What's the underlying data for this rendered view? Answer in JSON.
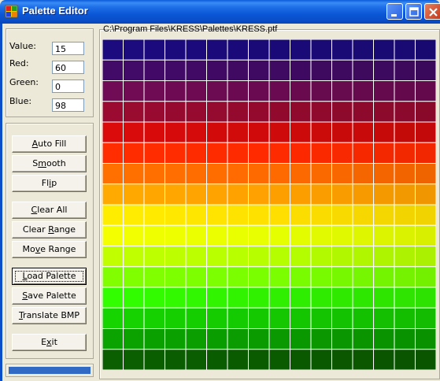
{
  "window": {
    "title": "Palette Editor",
    "icon": "palette-app-icon",
    "controls": [
      "minimize-icon",
      "maximize-icon",
      "close-icon"
    ]
  },
  "values": {
    "value_label": "Value:",
    "value": "15",
    "red_label": "Red:",
    "red": "60",
    "green_label": "Green:",
    "green": "0",
    "blue_label": "Blue:",
    "blue": "98"
  },
  "buttons": {
    "auto_fill": {
      "pre": "",
      "key": "A",
      "post": "uto Fill"
    },
    "smooth": {
      "pre": "S",
      "key": "m",
      "post": "ooth"
    },
    "flip": {
      "pre": "Fl",
      "key": "i",
      "post": "p"
    },
    "clear_all": {
      "pre": "",
      "key": "C",
      "post": "lear All"
    },
    "clear_range": {
      "pre": "Clear ",
      "key": "R",
      "post": "ange"
    },
    "move_range": {
      "pre": "Mo",
      "key": "v",
      "post": "e Range"
    },
    "load_palette": {
      "pre": "",
      "key": "L",
      "post": "oad Palette"
    },
    "save_palette": {
      "pre": "",
      "key": "S",
      "post": "ave Palette"
    },
    "translate_bmp": {
      "pre": "",
      "key": "T",
      "post": "ranslate BMP"
    },
    "exit": {
      "pre": "E",
      "key": "x",
      "post": "it"
    }
  },
  "status": {
    "progress": 1.0,
    "color": "#316ac5"
  },
  "palette": {
    "path": "C:\\Program Files\\KRESS\\Palettes\\KRESS.ptf",
    "columns": 16,
    "rows": 16,
    "grid_color": "#ffffff",
    "row_colors": [
      "#1a0a78",
      "#3f0a62",
      "#6a0a50",
      "#920a2e",
      "#cf0a0a",
      "#ff2a00",
      "#ff6a00",
      "#ffa000",
      "#ffe000",
      "#e6ff00",
      "#b6ff00",
      "#7aff00",
      "#30f000",
      "#14c800",
      "#0a9a00",
      "#0a5a00"
    ],
    "column_shift": 0.12
  }
}
